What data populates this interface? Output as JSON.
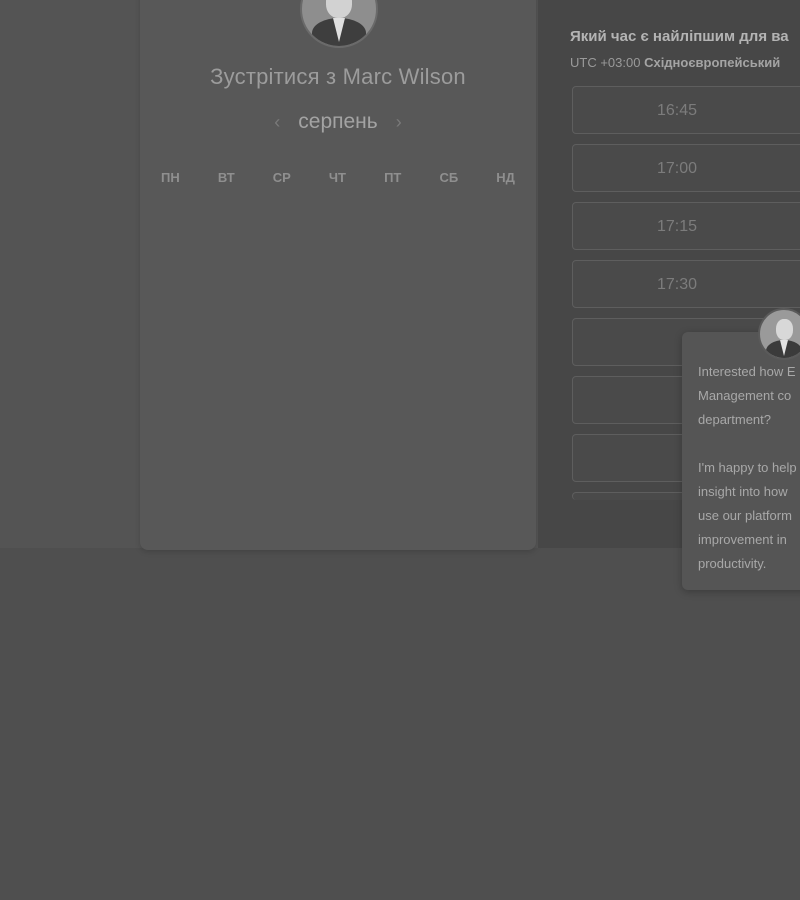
{
  "booking": {
    "title": "Зустрітися з Marc Wilson",
    "month": "серпень",
    "prev_icon": "chevron-left-icon",
    "next_icon": "chevron-right-icon",
    "weekdays": [
      "ПН",
      "ВТ",
      "СР",
      "ЧТ",
      "ПТ",
      "СБ",
      "НД"
    ]
  },
  "times": {
    "question": "Який час є найліпшим для ва",
    "tz_prefix": "UTC +03:00",
    "tz_name": "Східноєвропейський",
    "slots": [
      "16:45",
      "17:00",
      "17:15",
      "17:30",
      "",
      "",
      ""
    ]
  },
  "chat": {
    "message": "Interested how E\nManagement co\ndepartment?\n\nI'm happy to help\ninsight into how \nuse our platform\nimprovement in \nproductivity."
  }
}
